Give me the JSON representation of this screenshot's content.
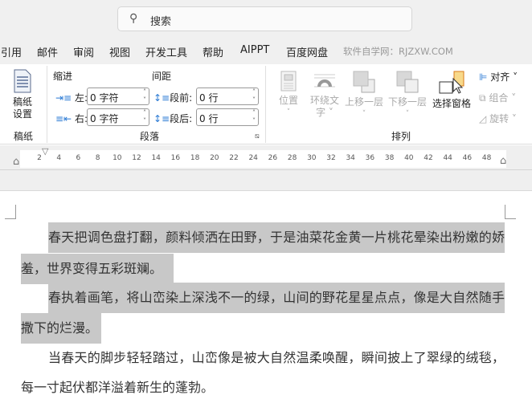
{
  "search": {
    "placeholder": "搜索",
    "icon": "search-icon"
  },
  "tabs": [
    "引用",
    "邮件",
    "审阅",
    "视图",
    "开发工具",
    "帮助",
    "AIPPT",
    "百度网盘"
  ],
  "watermark": "软件自学网：RJZXW.COM",
  "ribbon": {
    "gaozhi": {
      "button": [
        "稿纸",
        "设置"
      ],
      "group_label": "稿纸"
    },
    "paragraph": {
      "indent_label": "缩进",
      "spacing_label": "间距",
      "left_label": "左:",
      "left_value": "0 字符",
      "right_label": "右:",
      "right_value": "0 字符",
      "before_label": "段前:",
      "before_value": "0 行",
      "after_label": "段后:",
      "after_value": "0 行",
      "group_label": "段落"
    },
    "arrange": {
      "position": "位置",
      "wrap": [
        "环绕文",
        "字"
      ],
      "forward": "上移一层",
      "backward": "下移一层",
      "selection_pane": "选择窗格",
      "align": "对齐",
      "group": "组合",
      "rotate": "旋转",
      "group_label": "排列"
    }
  },
  "ruler": [
    "2",
    "4",
    "6",
    "8",
    "10",
    "12",
    "14",
    "16",
    "18",
    "20",
    "22",
    "24",
    "26",
    "28",
    "30",
    "32",
    "34",
    "36",
    "38",
    "40",
    "42",
    "44",
    "46",
    "48"
  ],
  "document": {
    "lines": [
      "春天把调色盘打翻，颜料倾洒在田野，于是油菜花金黄一片桃花晕染出粉嫩的娇",
      "羞，世界变得五彩斑斓。",
      "春执着画笔，将山峦染上深浅不一的绿，山间的野花星星点点，像是大自然随手",
      "撒下的烂漫。",
      "当春天的脚步轻轻踏过，山峦像是被大自然温柔唤醒，瞬间披上了翠绿的绒毯，",
      "每一寸起伏都洋溢着新生的蓬勃。"
    ],
    "selection_color": "#c8c8c8"
  }
}
